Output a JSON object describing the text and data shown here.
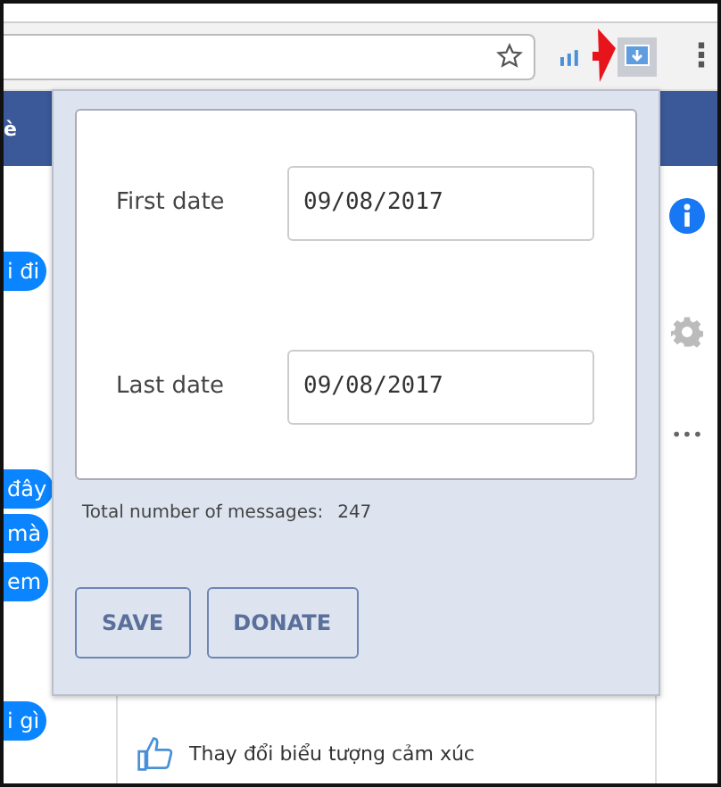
{
  "browser": {
    "menu_dots": "⋮"
  },
  "background": {
    "header_text": "è",
    "left_bubbles": [
      "i đi",
      "đây",
      "mà",
      "em",
      "i gì"
    ],
    "more": "•••",
    "reaction_row": "Thay đổi biểu tượng cảm xúc"
  },
  "popup": {
    "fields": [
      {
        "label": "First date",
        "value": "09/08/2017"
      },
      {
        "label": "Last date",
        "value": "09/08/2017"
      }
    ],
    "total_label": "Total number of messages:",
    "total_value": "247",
    "buttons": [
      "SAVE",
      "DONATE"
    ]
  }
}
